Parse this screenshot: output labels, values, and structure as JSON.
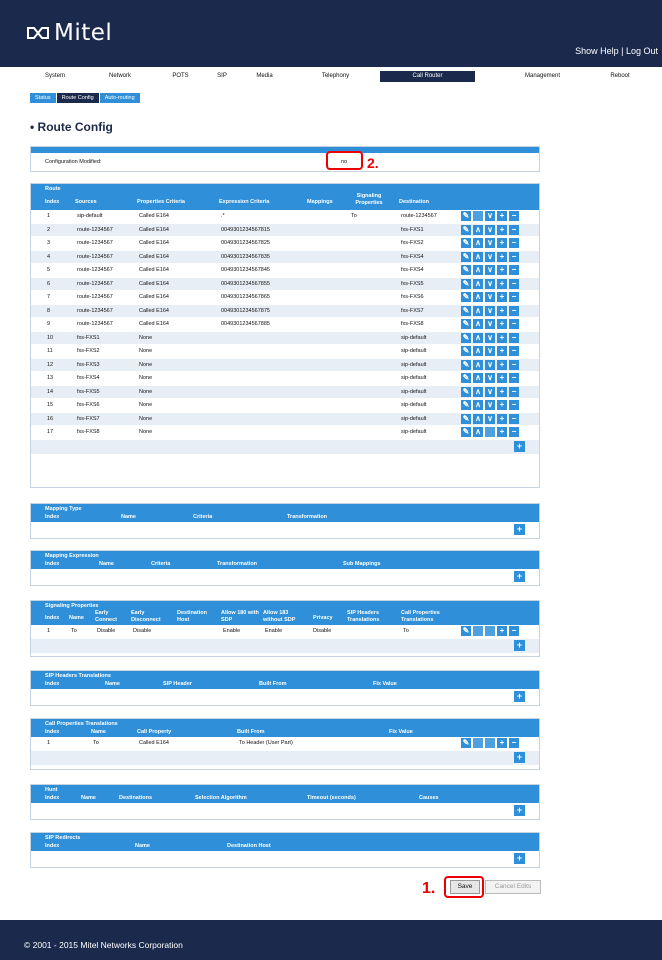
{
  "header": {
    "brand": "Mitel",
    "links": "Show Help | Log Out"
  },
  "nav": [
    "System",
    "Network",
    "POTS",
    "SIP",
    "Media",
    "Telephony",
    "Call Router",
    "Management",
    "Reboot"
  ],
  "subnav": [
    "Status",
    "Route Config",
    "Auto-routing"
  ],
  "page_title": "Route Config",
  "config": {
    "label": "Configuration Modified:",
    "value": "no"
  },
  "route": {
    "title": "Route",
    "headers": [
      "Index",
      "Sources",
      "Properties Criteria",
      "Expression Criteria",
      "Mappings",
      "Signaling Properties",
      "Destination"
    ],
    "rows": [
      [
        "1",
        "sip-default",
        "Called E164",
        ".*",
        "",
        "To",
        "route-1234567"
      ],
      [
        "2",
        "route-1234567",
        "Called E164",
        "0049301234567815",
        "",
        "",
        "fxs-FXS1"
      ],
      [
        "3",
        "route-1234567",
        "Called E164",
        "0049301234567825",
        "",
        "",
        "fxs-FXS2"
      ],
      [
        "4",
        "route-1234567",
        "Called E164",
        "0049301234567835",
        "",
        "",
        "fxs-FXS4"
      ],
      [
        "5",
        "route-1234567",
        "Called E164",
        "0049301234567845",
        "",
        "",
        "fxs-FXS4"
      ],
      [
        "6",
        "route-1234567",
        "Called E164",
        "0049301234567855",
        "",
        "",
        "fxs-FXS5"
      ],
      [
        "7",
        "route-1234567",
        "Called E164",
        "0049301234567865",
        "",
        "",
        "fxs-FXS6"
      ],
      [
        "8",
        "route-1234567",
        "Called E164",
        "0049301234567875",
        "",
        "",
        "fxs-FXS7"
      ],
      [
        "9",
        "route-1234567",
        "Called E164",
        "0049301234567885",
        "",
        "",
        "fxs-FXS8"
      ],
      [
        "10",
        "fxs-FXS1",
        "None",
        "",
        "",
        "",
        "sip-default"
      ],
      [
        "11",
        "fxs-FXS2",
        "None",
        "",
        "",
        "",
        "sip-default"
      ],
      [
        "12",
        "fxs-FXS3",
        "None",
        "",
        "",
        "",
        "sip-default"
      ],
      [
        "13",
        "fxs-FXS4",
        "None",
        "",
        "",
        "",
        "sip-default"
      ],
      [
        "14",
        "fxs-FXS5",
        "None",
        "",
        "",
        "",
        "sip-default"
      ],
      [
        "15",
        "fxs-FXS6",
        "None",
        "",
        "",
        "",
        "sip-default"
      ],
      [
        "16",
        "fxs-FXS7",
        "None",
        "",
        "",
        "",
        "sip-default"
      ],
      [
        "17",
        "fxs-FXS8",
        "None",
        "",
        "",
        "",
        "sip-default"
      ]
    ]
  },
  "mapping_type": {
    "title": "Mapping Type",
    "headers": [
      "Index",
      "Name",
      "Criteria",
      "Transformation"
    ]
  },
  "mapping_expr": {
    "title": "Mapping Expression",
    "headers": [
      "Index",
      "Name",
      "Criteria",
      "Transformation",
      "Sub Mappings"
    ]
  },
  "signaling": {
    "title": "Signaling Properties",
    "headers": [
      "Index",
      "Name",
      "Early Connect",
      "Early Disconnect",
      "Destination Host",
      "Allow 180 with SDP",
      "Allow 183 without SDP",
      "Privacy",
      "SIP Headers Translations",
      "Call Properties Translations"
    ],
    "row": [
      "1",
      "To",
      "Disable",
      "Disable",
      "",
      "Enable",
      "Enable",
      "Disable",
      "",
      "To"
    ]
  },
  "sip_headers": {
    "title": "SIP Headers Translations",
    "headers": [
      "Index",
      "Name",
      "SIP Header",
      "Built From",
      "Fix Value"
    ]
  },
  "call_props": {
    "title": "Call Properties Translations",
    "headers": [
      "Index",
      "Name",
      "Call Property",
      "Built From",
      "Fix Value"
    ],
    "row": [
      "1",
      "To",
      "Called E164",
      "To Header (User Part)",
      ""
    ]
  },
  "hunt": {
    "title": "Hunt",
    "headers": [
      "Index",
      "Name",
      "Destinations",
      "Selection Algorithm",
      "Timeout (seconds)",
      "Causes"
    ]
  },
  "sip_redirects": {
    "title": "SIP Redirects",
    "headers": [
      "Index",
      "Name",
      "Destination Host"
    ]
  },
  "buttons": {
    "save": "Save",
    "cancel": "Cancel Edits"
  },
  "annotations": {
    "one": "1.",
    "two": "2."
  },
  "footer": "© 2001 - 2015 Mitel Networks Corporation"
}
